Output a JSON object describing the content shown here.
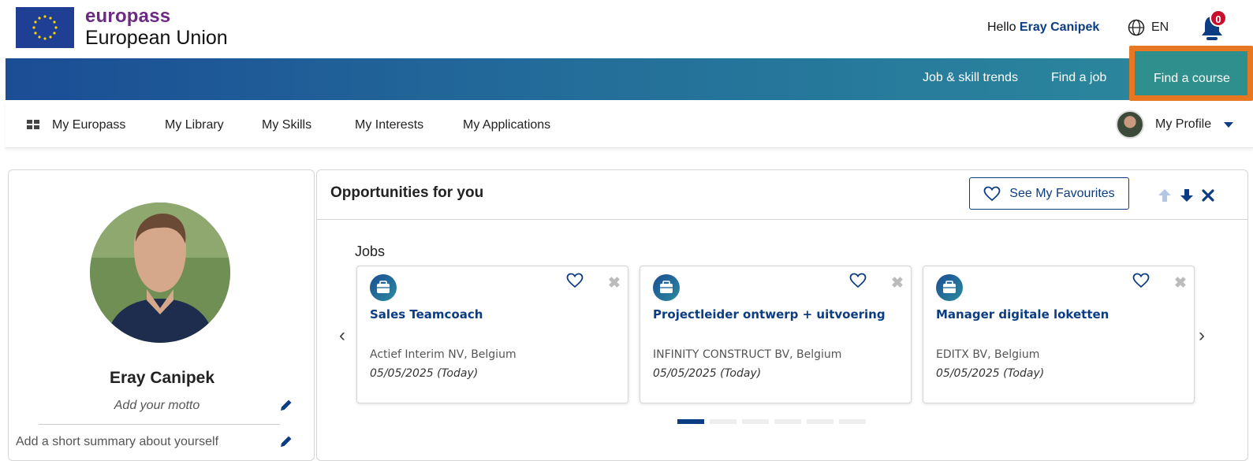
{
  "header": {
    "brand_top": "europass",
    "brand_bottom": "European Union",
    "greeting": "Hello",
    "user_name": "Eray Canipek",
    "language": "EN",
    "notifications_count": "0"
  },
  "top_nav": {
    "items": [
      {
        "label": "Job & skill trends"
      },
      {
        "label": "Find a job"
      },
      {
        "label": "Find a course"
      }
    ]
  },
  "sub_nav": {
    "items": [
      {
        "label": "My Europass"
      },
      {
        "label": "My Library"
      },
      {
        "label": "My Skills"
      },
      {
        "label": "My Interests"
      },
      {
        "label": "My Applications"
      }
    ],
    "profile_label": "My Profile"
  },
  "profile_card": {
    "name": "Eray Canipek",
    "motto_placeholder": "Add your motto",
    "summary_placeholder": "Add a short summary about yourself"
  },
  "opportunities": {
    "title": "Opportunities for you",
    "favourites_button": "See My Favourites",
    "section_label": "Jobs",
    "jobs": [
      {
        "title": "Sales Teamcoach",
        "company": "Actief Interim NV, Belgium",
        "date": "05/05/2025 (Today)"
      },
      {
        "title": "Projectleider ontwerp + uitvoering",
        "company": "INFINITY CONSTRUCT BV, Belgium",
        "date": "05/05/2025 (Today)"
      },
      {
        "title": "Manager digitale loketten",
        "company": "EDITX BV, Belgium",
        "date": "05/05/2025 (Today)"
      }
    ],
    "pagination_pages": 6,
    "pagination_active": 1
  },
  "colors": {
    "brand_purple": "#6c2a82",
    "primary_blue": "#0c3d82",
    "highlight_orange": "#e87722",
    "badge_red": "#c8102e"
  }
}
